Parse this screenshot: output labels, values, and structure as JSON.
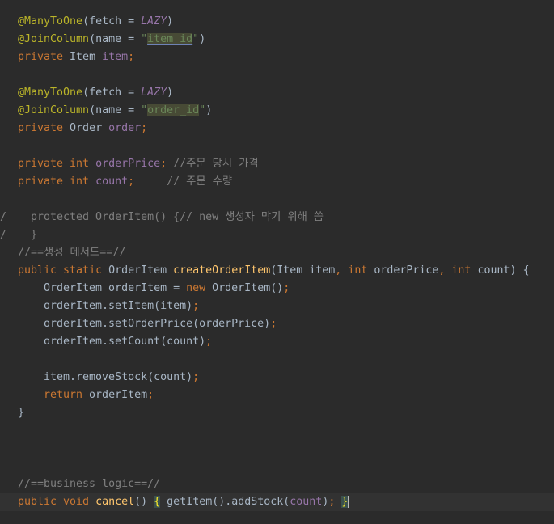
{
  "editor": {
    "lines": [
      {
        "indent": 1,
        "tokens": [
          {
            "t": "@ManyToOne",
            "c": "ann"
          },
          {
            "t": "(fetch = ",
            "c": "txt"
          },
          {
            "t": "LAZY",
            "c": "ital"
          },
          {
            "t": ")",
            "c": "txt"
          }
        ]
      },
      {
        "indent": 1,
        "tokens": [
          {
            "t": "@JoinColumn",
            "c": "ann"
          },
          {
            "t": "(name = ",
            "c": "txt"
          },
          {
            "t": "\"",
            "c": "str"
          },
          {
            "t": "item_id",
            "c": "strhl"
          },
          {
            "t": "\"",
            "c": "str"
          },
          {
            "t": ")",
            "c": "txt"
          }
        ]
      },
      {
        "indent": 1,
        "tokens": [
          {
            "t": "private ",
            "c": "kw"
          },
          {
            "t": "Item ",
            "c": "txt"
          },
          {
            "t": "item",
            "c": "fld"
          },
          {
            "t": ";",
            "c": "kw"
          }
        ]
      },
      {
        "indent": 0,
        "tokens": []
      },
      {
        "indent": 1,
        "tokens": [
          {
            "t": "@ManyToOne",
            "c": "ann"
          },
          {
            "t": "(fetch = ",
            "c": "txt"
          },
          {
            "t": "LAZY",
            "c": "ital"
          },
          {
            "t": ")",
            "c": "txt"
          }
        ]
      },
      {
        "indent": 1,
        "tokens": [
          {
            "t": "@JoinColumn",
            "c": "ann"
          },
          {
            "t": "(name = ",
            "c": "txt"
          },
          {
            "t": "\"",
            "c": "str"
          },
          {
            "t": "order_id",
            "c": "strhl"
          },
          {
            "t": "\"",
            "c": "str"
          },
          {
            "t": ")",
            "c": "txt"
          }
        ]
      },
      {
        "indent": 1,
        "tokens": [
          {
            "t": "private ",
            "c": "kw"
          },
          {
            "t": "Order ",
            "c": "txt"
          },
          {
            "t": "order",
            "c": "fld"
          },
          {
            "t": ";",
            "c": "kw"
          }
        ]
      },
      {
        "indent": 0,
        "tokens": []
      },
      {
        "indent": 1,
        "tokens": [
          {
            "t": "private int ",
            "c": "kw"
          },
          {
            "t": "orderPrice",
            "c": "fld"
          },
          {
            "t": "; ",
            "c": "kw"
          },
          {
            "t": "//주문 당시 가격",
            "c": "cmt"
          }
        ]
      },
      {
        "indent": 1,
        "tokens": [
          {
            "t": "private int ",
            "c": "kw"
          },
          {
            "t": "count",
            "c": "fld"
          },
          {
            "t": ";     ",
            "c": "kw"
          },
          {
            "t": "// 주문 수량",
            "c": "cmt"
          }
        ]
      },
      {
        "indent": 0,
        "tokens": []
      },
      {
        "indent": "commented",
        "gutter": "/",
        "tokens": [
          {
            "t": "protected OrderItem() {// new 생성자 막기 위해 씀",
            "c": "dis"
          }
        ]
      },
      {
        "indent": "commented",
        "gutter": "/",
        "tokens": [
          {
            "t": "}",
            "c": "dis"
          }
        ]
      },
      {
        "indent": 1,
        "tokens": [
          {
            "t": "//==생성 메서드==//",
            "c": "cmt"
          }
        ]
      },
      {
        "indent": 1,
        "tokens": [
          {
            "t": "public static ",
            "c": "kw"
          },
          {
            "t": "OrderItem ",
            "c": "txt"
          },
          {
            "t": "createOrderItem",
            "c": "mdecl"
          },
          {
            "t": "(Item item",
            "c": "txt"
          },
          {
            "t": ", int ",
            "c": "kw"
          },
          {
            "t": "orderPrice",
            "c": "txt"
          },
          {
            "t": ", int ",
            "c": "kw"
          },
          {
            "t": "count) {",
            "c": "txt"
          }
        ]
      },
      {
        "indent": 2,
        "tokens": [
          {
            "t": "OrderItem orderItem = ",
            "c": "txt"
          },
          {
            "t": "new ",
            "c": "kw"
          },
          {
            "t": "OrderItem()",
            "c": "txt"
          },
          {
            "t": ";",
            "c": "kw"
          }
        ]
      },
      {
        "indent": 2,
        "tokens": [
          {
            "t": "orderItem.setItem(item)",
            "c": "txt"
          },
          {
            "t": ";",
            "c": "kw"
          }
        ]
      },
      {
        "indent": 2,
        "tokens": [
          {
            "t": "orderItem.setOrderPrice(orderPrice)",
            "c": "txt"
          },
          {
            "t": ";",
            "c": "kw"
          }
        ]
      },
      {
        "indent": 2,
        "tokens": [
          {
            "t": "orderItem.setCount(count)",
            "c": "txt"
          },
          {
            "t": ";",
            "c": "kw"
          }
        ]
      },
      {
        "indent": 0,
        "tokens": []
      },
      {
        "indent": 2,
        "tokens": [
          {
            "t": "item.removeStock(count)",
            "c": "txt"
          },
          {
            "t": ";",
            "c": "kw"
          }
        ]
      },
      {
        "indent": 2,
        "tokens": [
          {
            "t": "return ",
            "c": "kw"
          },
          {
            "t": "orderItem",
            "c": "txt"
          },
          {
            "t": ";",
            "c": "kw"
          }
        ]
      },
      {
        "indent": 1,
        "tokens": [
          {
            "t": "}",
            "c": "txt"
          }
        ]
      },
      {
        "indent": 0,
        "tokens": []
      },
      {
        "indent": 0,
        "tokens": []
      },
      {
        "indent": 0,
        "tokens": []
      },
      {
        "indent": 1,
        "tokens": [
          {
            "t": "//==business logic==//",
            "c": "cmt"
          }
        ]
      },
      {
        "indent": 1,
        "current": true,
        "tokens": [
          {
            "t": "public void ",
            "c": "kw"
          },
          {
            "t": "cancel",
            "c": "mdecl"
          },
          {
            "t": "() ",
            "c": "txt"
          },
          {
            "t": "{",
            "c": "brace"
          },
          {
            "t": " getItem().addStock(",
            "c": "txt"
          },
          {
            "t": "count",
            "c": "fld"
          },
          {
            "t": ")",
            "c": "txt"
          },
          {
            "t": "; ",
            "c": "kw"
          },
          {
            "t": "}",
            "c": "brace caret"
          }
        ]
      }
    ]
  }
}
